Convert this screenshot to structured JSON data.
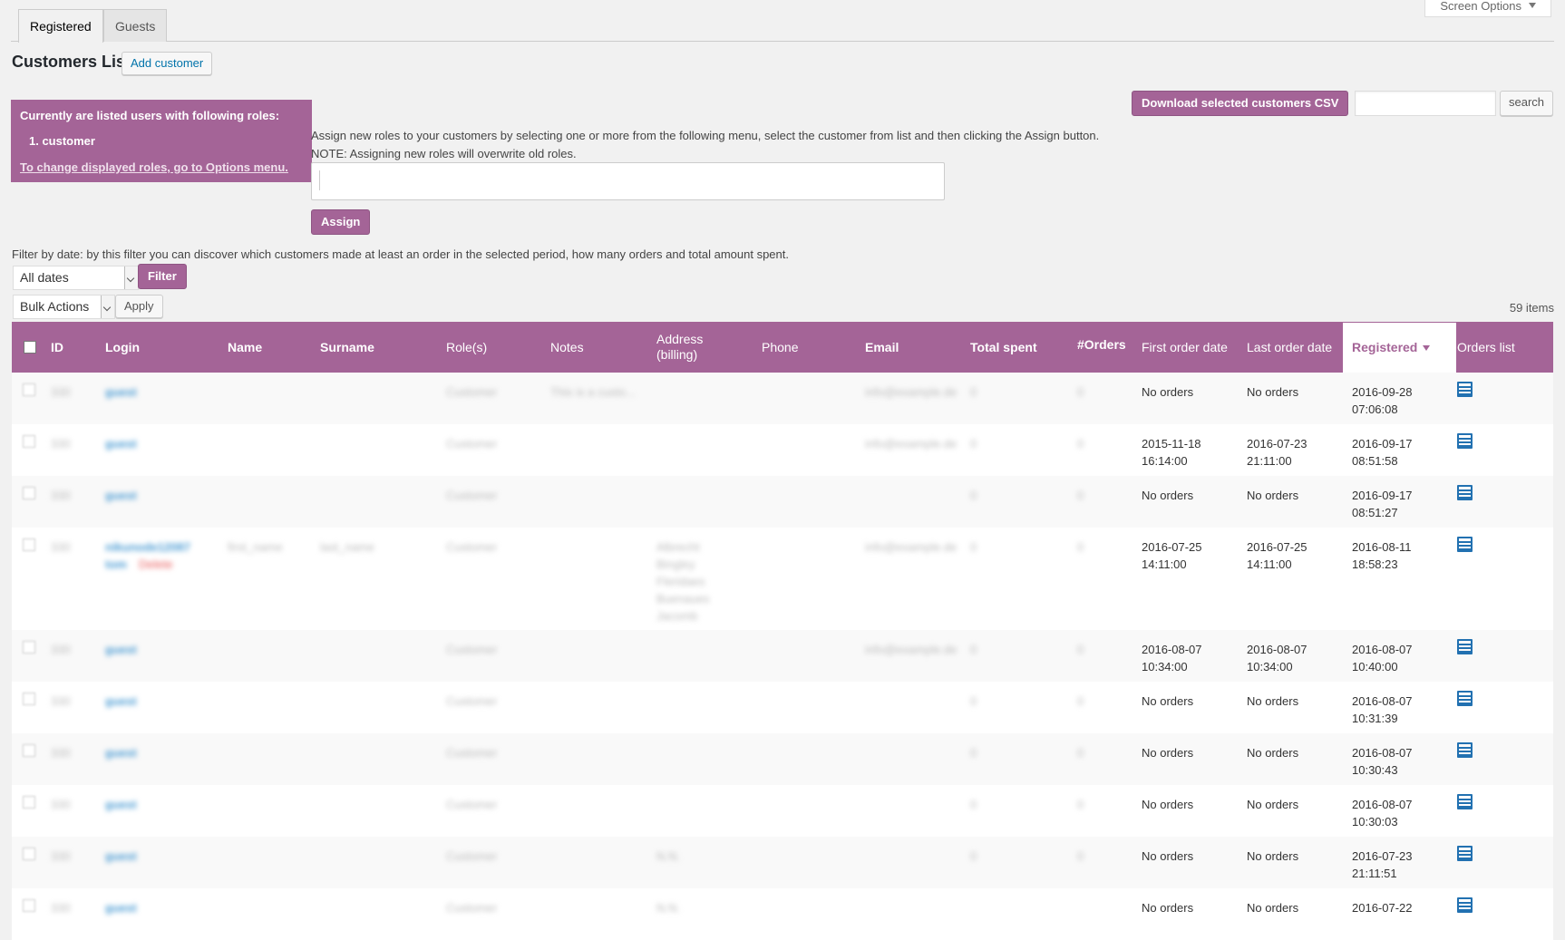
{
  "tabs": [
    "Registered",
    "Guests"
  ],
  "screen_options": "Screen Options",
  "title": "Customers List",
  "add_customer": "Add customer",
  "download_csv": "Download selected customers CSV",
  "search_label": "search",
  "roles_box": {
    "line1": "Currently are listed users with following roles:",
    "line2": "1. customer",
    "link": "To change displayed roles, go to Options menu."
  },
  "assign_desc": "Assign new roles to your customers by selecting one or more from the following menu, select the customer from list and then clicking the Assign button.",
  "assign_note": "NOTE: Assigning new roles will overwrite old roles.",
  "assign_btn": "Assign",
  "filter_desc": "Filter by date: by this filter you can discover which customers made at least an order in the selected period, how many orders and total amount spent.",
  "date_select": "All dates",
  "filter_btn": "Filter",
  "bulk_select": "Bulk Actions",
  "apply_btn": "Apply",
  "items_count": "59 items",
  "columns": {
    "id": "ID",
    "login": "Login",
    "name": "Name",
    "surname": "Surname",
    "roles": "Role(s)",
    "notes": "Notes",
    "address": "Address (billing)",
    "phone": "Phone",
    "email": "Email",
    "total": "Total spent",
    "orders": "#Orders",
    "first": "First order date",
    "last": "Last order date",
    "registered": "Registered",
    "orders_list": "Orders list"
  },
  "rows": [
    {
      "first": "No orders",
      "last": "No orders",
      "registered": "2016-09-28 07:06:08"
    },
    {
      "first": "2015-11-18 16:14:00",
      "last": "2016-07-23 21:11:00",
      "registered": "2016-09-17 08:51:58"
    },
    {
      "first": "No orders",
      "last": "No orders",
      "registered": "2016-09-17 08:51:27"
    },
    {
      "first": "2016-07-25 14:11:00",
      "last": "2016-07-25 14:11:00",
      "registered": "2016-08-11 18:58:23"
    },
    {
      "first": "2016-08-07 10:34:00",
      "last": "2016-08-07 10:34:00",
      "registered": "2016-08-07 10:40:00"
    },
    {
      "first": "No orders",
      "last": "No orders",
      "registered": "2016-08-07 10:31:39"
    },
    {
      "first": "No orders",
      "last": "No orders",
      "registered": "2016-08-07 10:30:43"
    },
    {
      "first": "No orders",
      "last": "No orders",
      "registered": "2016-08-07 10:30:03"
    },
    {
      "first": "No orders",
      "last": "No orders",
      "registered": "2016-07-23 21:11:51"
    },
    {
      "first": "No orders",
      "last": "No orders",
      "registered": "2016-07-22"
    }
  ],
  "blurred": {
    "id": "330",
    "login": "guest",
    "role": "Customer",
    "note": "This is a custo...",
    "email": "info@example.de",
    "amount": "0",
    "count": "0",
    "login2": "nikunode12087 tom",
    "delete": "Delete",
    "name": "first_name",
    "surname": "last_name",
    "address": "Albrecht Bingley Fleridaes Buenaues Jacomb",
    "address_short": "N.N."
  }
}
